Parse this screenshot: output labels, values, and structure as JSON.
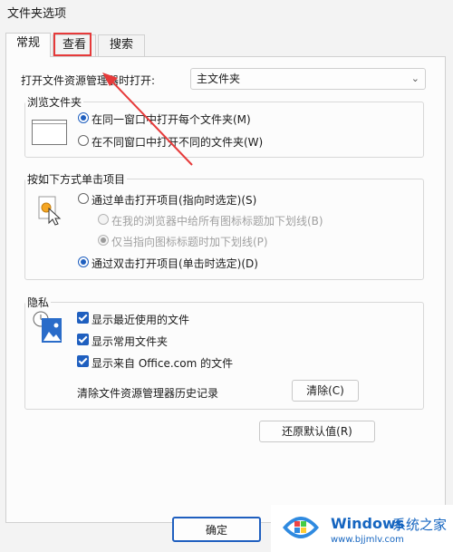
{
  "window": {
    "title": "文件夹选项"
  },
  "tabs": [
    {
      "label": "常规"
    },
    {
      "label": "查看"
    },
    {
      "label": "搜索"
    }
  ],
  "open_explorer": {
    "label": "打开文件资源管理器时打开:",
    "selected": "主文件夹"
  },
  "browse": {
    "title": "浏览文件夹",
    "opt_same": "在同一窗口中打开每个文件夹(M)",
    "opt_new": "在不同窗口中打开不同的文件夹(W)"
  },
  "click": {
    "title": "按如下方式单击项目",
    "opt_single": "通过单击打开项目(指向时选定)(S)",
    "opt_underline_browser": "在我的浏览器中给所有图标标题加下划线(B)",
    "opt_underline_point": "仅当指向图标标题时加下划线(P)",
    "opt_double": "通过双击打开项目(单击时选定)(D)"
  },
  "privacy": {
    "title": "隐私",
    "show_recent": "显示最近使用的文件",
    "show_frequent": "显示常用文件夹",
    "show_office": "显示来自 Office.com 的文件",
    "clear_history_label": "清除文件资源管理器历史记录",
    "clear_button": "清除(C)"
  },
  "restore_button": "还原默认值(R)",
  "ok_button": "确定",
  "watermark": {
    "brand": "Windows",
    "brand_cn": "系统之家",
    "url": "www.bjjmlv.com"
  },
  "colors": {
    "accent": "#1f5fbf",
    "annotation": "#e63a3a"
  }
}
